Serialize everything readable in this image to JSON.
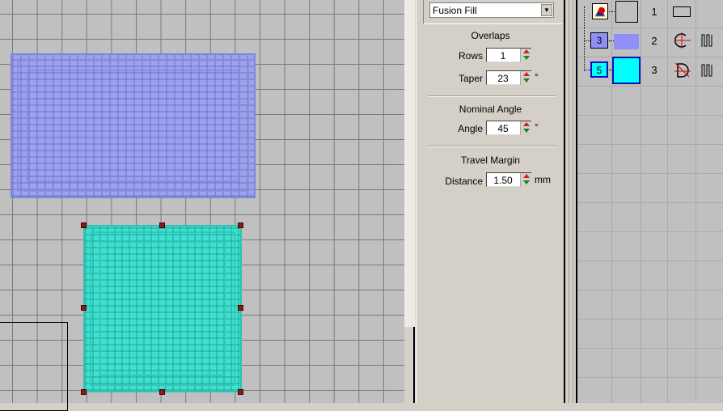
{
  "fill_type": {
    "value": "Fusion Fill"
  },
  "overlaps": {
    "title": "Overlaps",
    "rows_label": "Rows",
    "rows_value": "1",
    "taper_label": "Taper",
    "taper_value": "23",
    "taper_unit": "°"
  },
  "nominal_angle": {
    "title": "Nominal Angle",
    "angle_label": "Angle",
    "angle_value": "45",
    "angle_unit": "°"
  },
  "travel_margin": {
    "title": "Travel Margin",
    "distance_label": "Distance",
    "distance_value": "1.50",
    "distance_unit": "mm"
  },
  "objects": [
    {
      "number": "1",
      "badge": "",
      "color": "#c0c0c0",
      "shape": "rectangle-outline"
    },
    {
      "number": "2",
      "badge": "3",
      "color": "#8f8ff8",
      "shape": "circle-fill",
      "stitch": "zigzag"
    },
    {
      "number": "3",
      "badge": "5",
      "color": "#00ffff",
      "shape": "d-shape-fill",
      "stitch": "zigzag"
    }
  ],
  "colors": {
    "blue_object": "#9da2ee",
    "cyan_object": "#3fe0d0",
    "handle": "#8b1a1a"
  }
}
